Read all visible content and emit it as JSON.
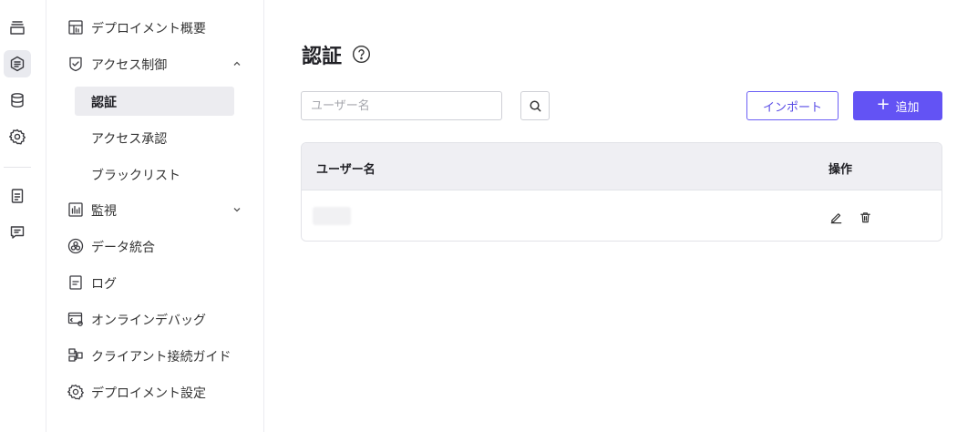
{
  "rail": {
    "items": [
      {
        "icon": "layers-icon"
      },
      {
        "icon": "stack-list-icon",
        "active": true
      },
      {
        "icon": "database-icon"
      },
      {
        "icon": "gear-icon"
      },
      {
        "icon": "document-icon"
      },
      {
        "icon": "message-icon"
      }
    ]
  },
  "sidebar": {
    "items": [
      {
        "label": "デプロイメント概要",
        "icon": "dashboard-icon"
      },
      {
        "label": "アクセス制御",
        "icon": "shield-check-icon",
        "expanded": true,
        "children": [
          {
            "label": "認証",
            "active": true
          },
          {
            "label": "アクセス承認"
          },
          {
            "label": "ブラックリスト"
          }
        ]
      },
      {
        "label": "監視",
        "icon": "bar-chart-icon",
        "expanded": false
      },
      {
        "label": "データ統合",
        "icon": "integration-icon"
      },
      {
        "label": "ログ",
        "icon": "log-icon"
      },
      {
        "label": "オンラインデバッグ",
        "icon": "debug-icon"
      },
      {
        "label": "クライアント接続ガイド",
        "icon": "client-guide-icon"
      },
      {
        "label": "デプロイメント設定",
        "icon": "gear-icon"
      }
    ]
  },
  "page": {
    "title": "認証",
    "help_icon": "help-icon"
  },
  "search": {
    "placeholder": "ユーザー名",
    "value": ""
  },
  "toolbar": {
    "import_label": "インポート",
    "add_label": "追加",
    "accent_color": "#6353f4"
  },
  "table": {
    "columns": [
      "ユーザー名",
      "操作"
    ],
    "rows": [
      {
        "username": "",
        "actions": [
          "edit-icon",
          "delete-icon"
        ]
      }
    ]
  }
}
